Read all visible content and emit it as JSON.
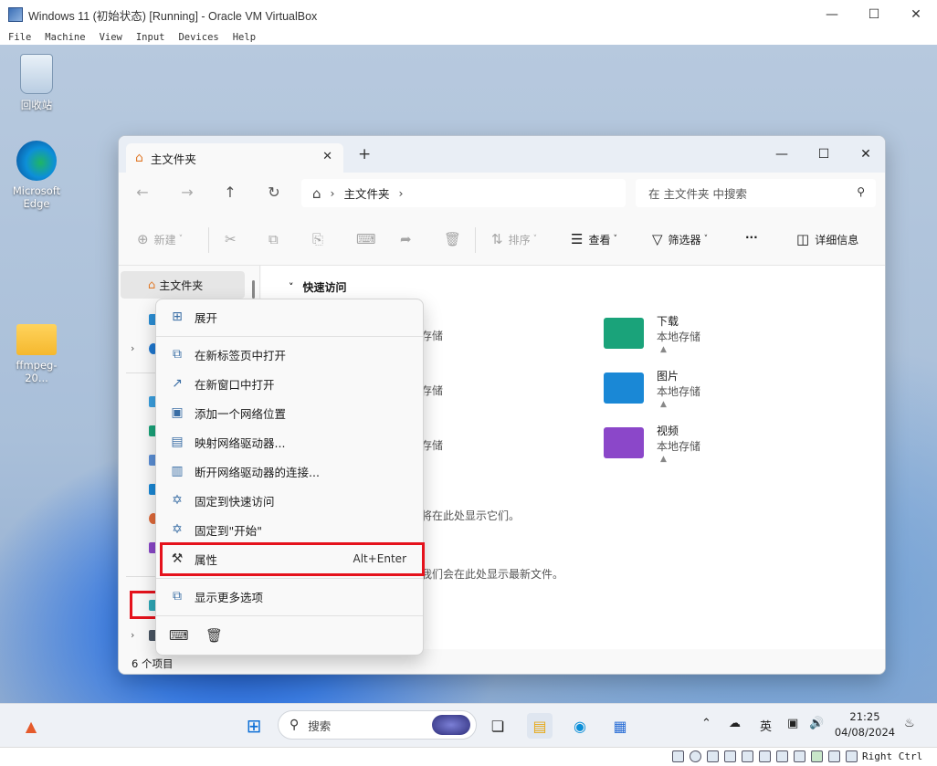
{
  "vbox": {
    "title": "Windows 11 (初始状态) [Running] - Oracle VM VirtualBox",
    "menu": [
      "File",
      "Machine",
      "View",
      "Input",
      "Devices",
      "Help"
    ],
    "host_key": "Right Ctrl"
  },
  "desktop": {
    "icons": [
      {
        "label": "回收站",
        "icon": "recycle-bin-icon"
      },
      {
        "label": "Microsoft Edge",
        "icon": "edge-icon"
      },
      {
        "label": "ffmpeg-20...",
        "icon": "folder-icon"
      }
    ]
  },
  "explorer": {
    "tab_title": "主文件夹",
    "address": {
      "crumb": "主文件夹"
    },
    "search_placeholder": "在 主文件夹 中搜索",
    "toolbar": {
      "new": "新建",
      "sort": "排序",
      "view": "查看",
      "filter": "筛选器",
      "more": "···",
      "details": "详细信息"
    },
    "nav": {
      "home": "主文件夹"
    },
    "quick_access": {
      "header": "快速访问",
      "left_subs": [
        "存储",
        "存储",
        "存储"
      ],
      "tiles": [
        {
          "name": "下载",
          "sub": "本地存储",
          "color": "#1aa37a"
        },
        {
          "name": "图片",
          "sub": "本地存储",
          "color": "#1a88d6"
        },
        {
          "name": "视频",
          "sub": "本地存储",
          "color": "#8b47c9"
        }
      ]
    },
    "notes": [
      "将在此处显示它们。",
      "我们会在此处显示最新文件。"
    ],
    "status": "6 个项目"
  },
  "context_menu": {
    "items": [
      {
        "label": "展开",
        "icon": "expand-icon"
      },
      {
        "label": "在新标签页中打开",
        "icon": "new-tab-icon"
      },
      {
        "label": "在新窗口中打开",
        "icon": "new-window-icon"
      },
      {
        "label": "添加一个网络位置",
        "icon": "network-location-icon"
      },
      {
        "label": "映射网络驱动器...",
        "icon": "map-drive-icon"
      },
      {
        "label": "断开网络驱动器的连接...",
        "icon": "disconnect-drive-icon"
      },
      {
        "label": "固定到快速访问",
        "icon": "pin-icon"
      },
      {
        "label": "固定到\"开始\"",
        "icon": "pin-start-icon"
      },
      {
        "label": "属性",
        "icon": "wrench-icon",
        "shortcut": "Alt+Enter"
      },
      {
        "label": "显示更多选项",
        "icon": "more-options-icon"
      }
    ]
  },
  "taskbar": {
    "search_label": "搜索",
    "ime": "英",
    "time": "21:25",
    "date": "04/08/2024"
  },
  "colors": {
    "highlight": "#e5121c",
    "accent": "#0b5ea8"
  }
}
